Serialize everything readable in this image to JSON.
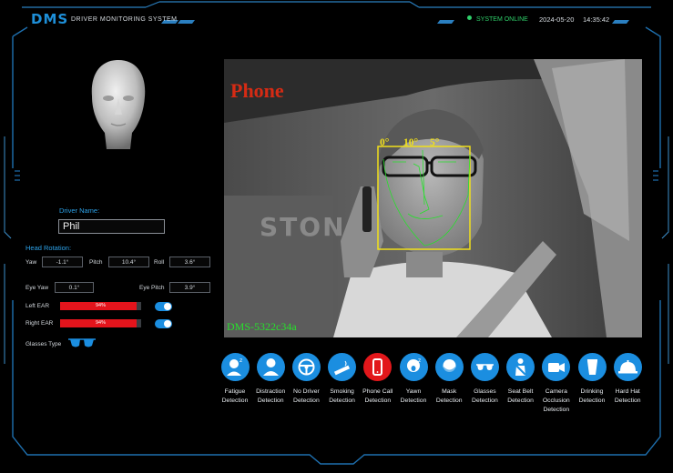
{
  "header": {
    "logo": "DMS",
    "subtitle": "DRIVER MONITORING SYSTEM",
    "status": "SYSTEM ONLINE",
    "date": "2024-05-20",
    "time": "14:35:42"
  },
  "colors": {
    "accent": "#1b8ee0",
    "alert": "#e2171b",
    "online": "#2fd06a",
    "frame": "#1e6fae"
  },
  "driver": {
    "name_label": "Driver Name:",
    "name_value": "Phil"
  },
  "head_rotation": {
    "title": "Head Rotation:",
    "yaw_label": "Yaw",
    "yaw_value": "-1.1°",
    "pitch_label": "Pitch",
    "pitch_value": "10.4°",
    "roll_label": "Roll",
    "roll_value": "3.6°"
  },
  "eye": {
    "yaw_label": "Eye Yaw",
    "yaw_value": "0.1°",
    "pitch_label": "Eye Pitch",
    "pitch_value": "3.9°"
  },
  "ear": {
    "left_label": "Left EAR",
    "left_value": "94%",
    "left_fraction": 0.94,
    "right_label": "Right EAR",
    "right_value": "94%",
    "right_fraction": 0.94
  },
  "glasses": {
    "label": "Glasses Type",
    "icon": "sunglasses-icon"
  },
  "video": {
    "detected_label": "Phone",
    "device_id": "DMS-5322c34a",
    "watermark": "STON",
    "angle_1": "0°",
    "angle_2": "10°",
    "angle_3": "5°"
  },
  "detections": [
    {
      "name": "fatigue",
      "line1": "Fatigue",
      "line2": "Detection",
      "line3": "",
      "icon": "fatigue-icon",
      "active": false
    },
    {
      "name": "distraction",
      "line1": "Distraction",
      "line2": "Detection",
      "line3": "",
      "icon": "distraction-icon",
      "active": false
    },
    {
      "name": "no-driver",
      "line1": "No Driver",
      "line2": "Detection",
      "line3": "",
      "icon": "steering-wheel-icon",
      "active": false
    },
    {
      "name": "smoking",
      "line1": "Smoking",
      "line2": "Detection",
      "line3": "",
      "icon": "cigarette-icon",
      "active": false
    },
    {
      "name": "phone-call",
      "line1": "Phone Call",
      "line2": "Detection",
      "line3": "",
      "icon": "phone-icon",
      "active": true
    },
    {
      "name": "yawn",
      "line1": "Yawn",
      "line2": "Detection",
      "line3": "",
      "icon": "yawn-icon",
      "active": false
    },
    {
      "name": "mask",
      "line1": "Mask",
      "line2": "Detection",
      "line3": "",
      "icon": "mask-icon",
      "active": false
    },
    {
      "name": "glasses",
      "line1": "Glasses",
      "line2": "Detection",
      "line3": "",
      "icon": "glasses-icon",
      "active": false
    },
    {
      "name": "seat-belt",
      "line1": "Seat Belt",
      "line2": "Detection",
      "line3": "",
      "icon": "seat-belt-icon",
      "active": false
    },
    {
      "name": "camera-occlusion",
      "line1": "Camera",
      "line2": "Occlusion",
      "line3": "Detection",
      "icon": "camera-icon",
      "active": false
    },
    {
      "name": "drinking",
      "line1": "Drinking",
      "line2": "Detection",
      "line3": "",
      "icon": "cup-icon",
      "active": false
    },
    {
      "name": "hard-hat",
      "line1": "Hard Hat",
      "line2": "Detection",
      "line3": "",
      "icon": "hard-hat-icon",
      "active": false
    }
  ]
}
